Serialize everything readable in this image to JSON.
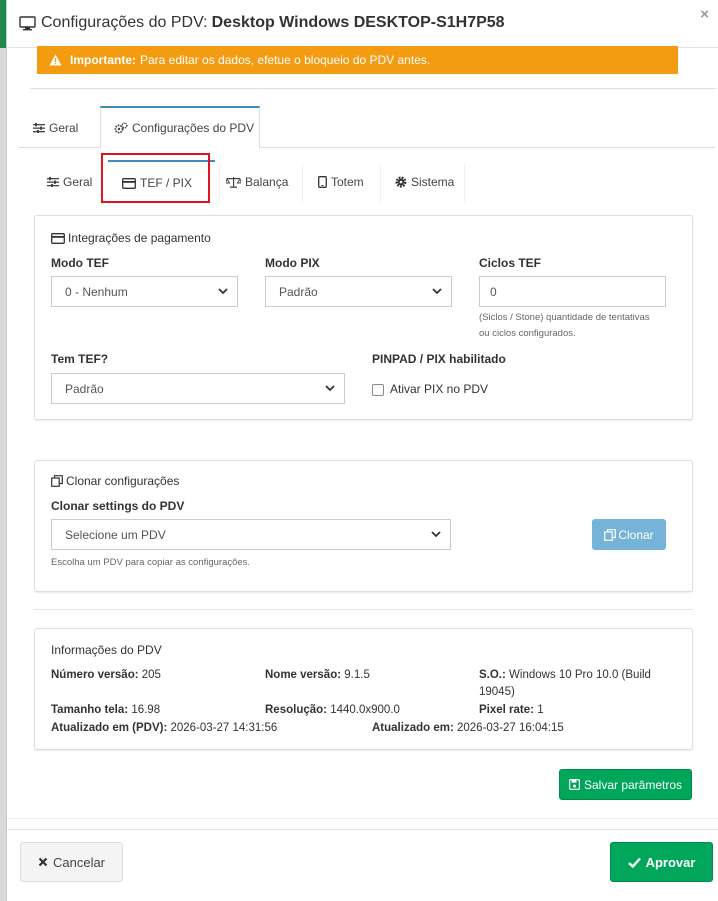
{
  "modal": {
    "title_prefix": "Configurações do PDV:",
    "title_device": "Desktop Windows DESKTOP-S1H7P58",
    "close_label": "×"
  },
  "alert": {
    "strong": "Importante:",
    "text": "Para editar os dados, efetue o bloqueio do PDV antes."
  },
  "tabs_top": [
    {
      "label": "Geral"
    },
    {
      "label": "Configurações do PDV"
    }
  ],
  "tabs_sub": [
    {
      "label": "Geral"
    },
    {
      "label": "TEF / PIX"
    },
    {
      "label": "Balança"
    },
    {
      "label": "Totem"
    },
    {
      "label": "Sistema"
    }
  ],
  "payments": {
    "title": "Integrações de pagamento",
    "modo_tef_label": "Modo TEF",
    "modo_tef_value": "0 - Nenhum",
    "modo_pix_label": "Modo PIX",
    "modo_pix_value": "Padrão",
    "ciclos_tef_label": "Ciclos TEF",
    "ciclos_tef_value": "0",
    "ciclos_help_1": "(Siclos / Stone) quantidade de tentativas",
    "ciclos_help_2": "ou ciclos configurados.",
    "tem_tef_label": "Tem TEF?",
    "tem_tef_value": "Padrão",
    "pinpad_label": "PINPAD / PIX habilitado",
    "pinpad_checkbox_label": "Ativar PIX no PDV",
    "pinpad_checked": false
  },
  "clone": {
    "title": "Clonar configurações",
    "label": "Clonar settings do PDV",
    "select_value": "Selecione um PDV",
    "help": "Escolha um PDV para copiar as configurações.",
    "button": "Clonar"
  },
  "info": {
    "title": "Informações do PDV",
    "numero_versao_label": "Número versão:",
    "numero_versao": "205",
    "nome_versao_label": "Nome versão:",
    "nome_versao": "9.1.5",
    "so_label": "S.O.:",
    "so_line1": "Windows 10 Pro 10.0 (Build",
    "so_line2": "19045)",
    "tamanho_label": "Tamanho tela:",
    "tamanho": "16.98",
    "resolucao_label": "Resolução:",
    "resolucao": "1440.0x900.0",
    "pixel_label": "Pixel rate:",
    "pixel": "1",
    "atualizado_pdv_label": "Atualizado em (PDV):",
    "atualizado_pdv": "2026-03-27 14:31:56",
    "atualizado_label": "Atualizado em:",
    "atualizado": "2026-03-27 16:04:15"
  },
  "buttons": {
    "salvar": "Salvar parâmetros",
    "cancelar": "Cancelar",
    "aprovar": "Aprovar"
  },
  "colors": {
    "warning": "#f39c12",
    "success": "#00a65a",
    "info_disabled": "#76b3d8",
    "tab_active": "#3c8dbc",
    "highlight": "#e0141e"
  }
}
